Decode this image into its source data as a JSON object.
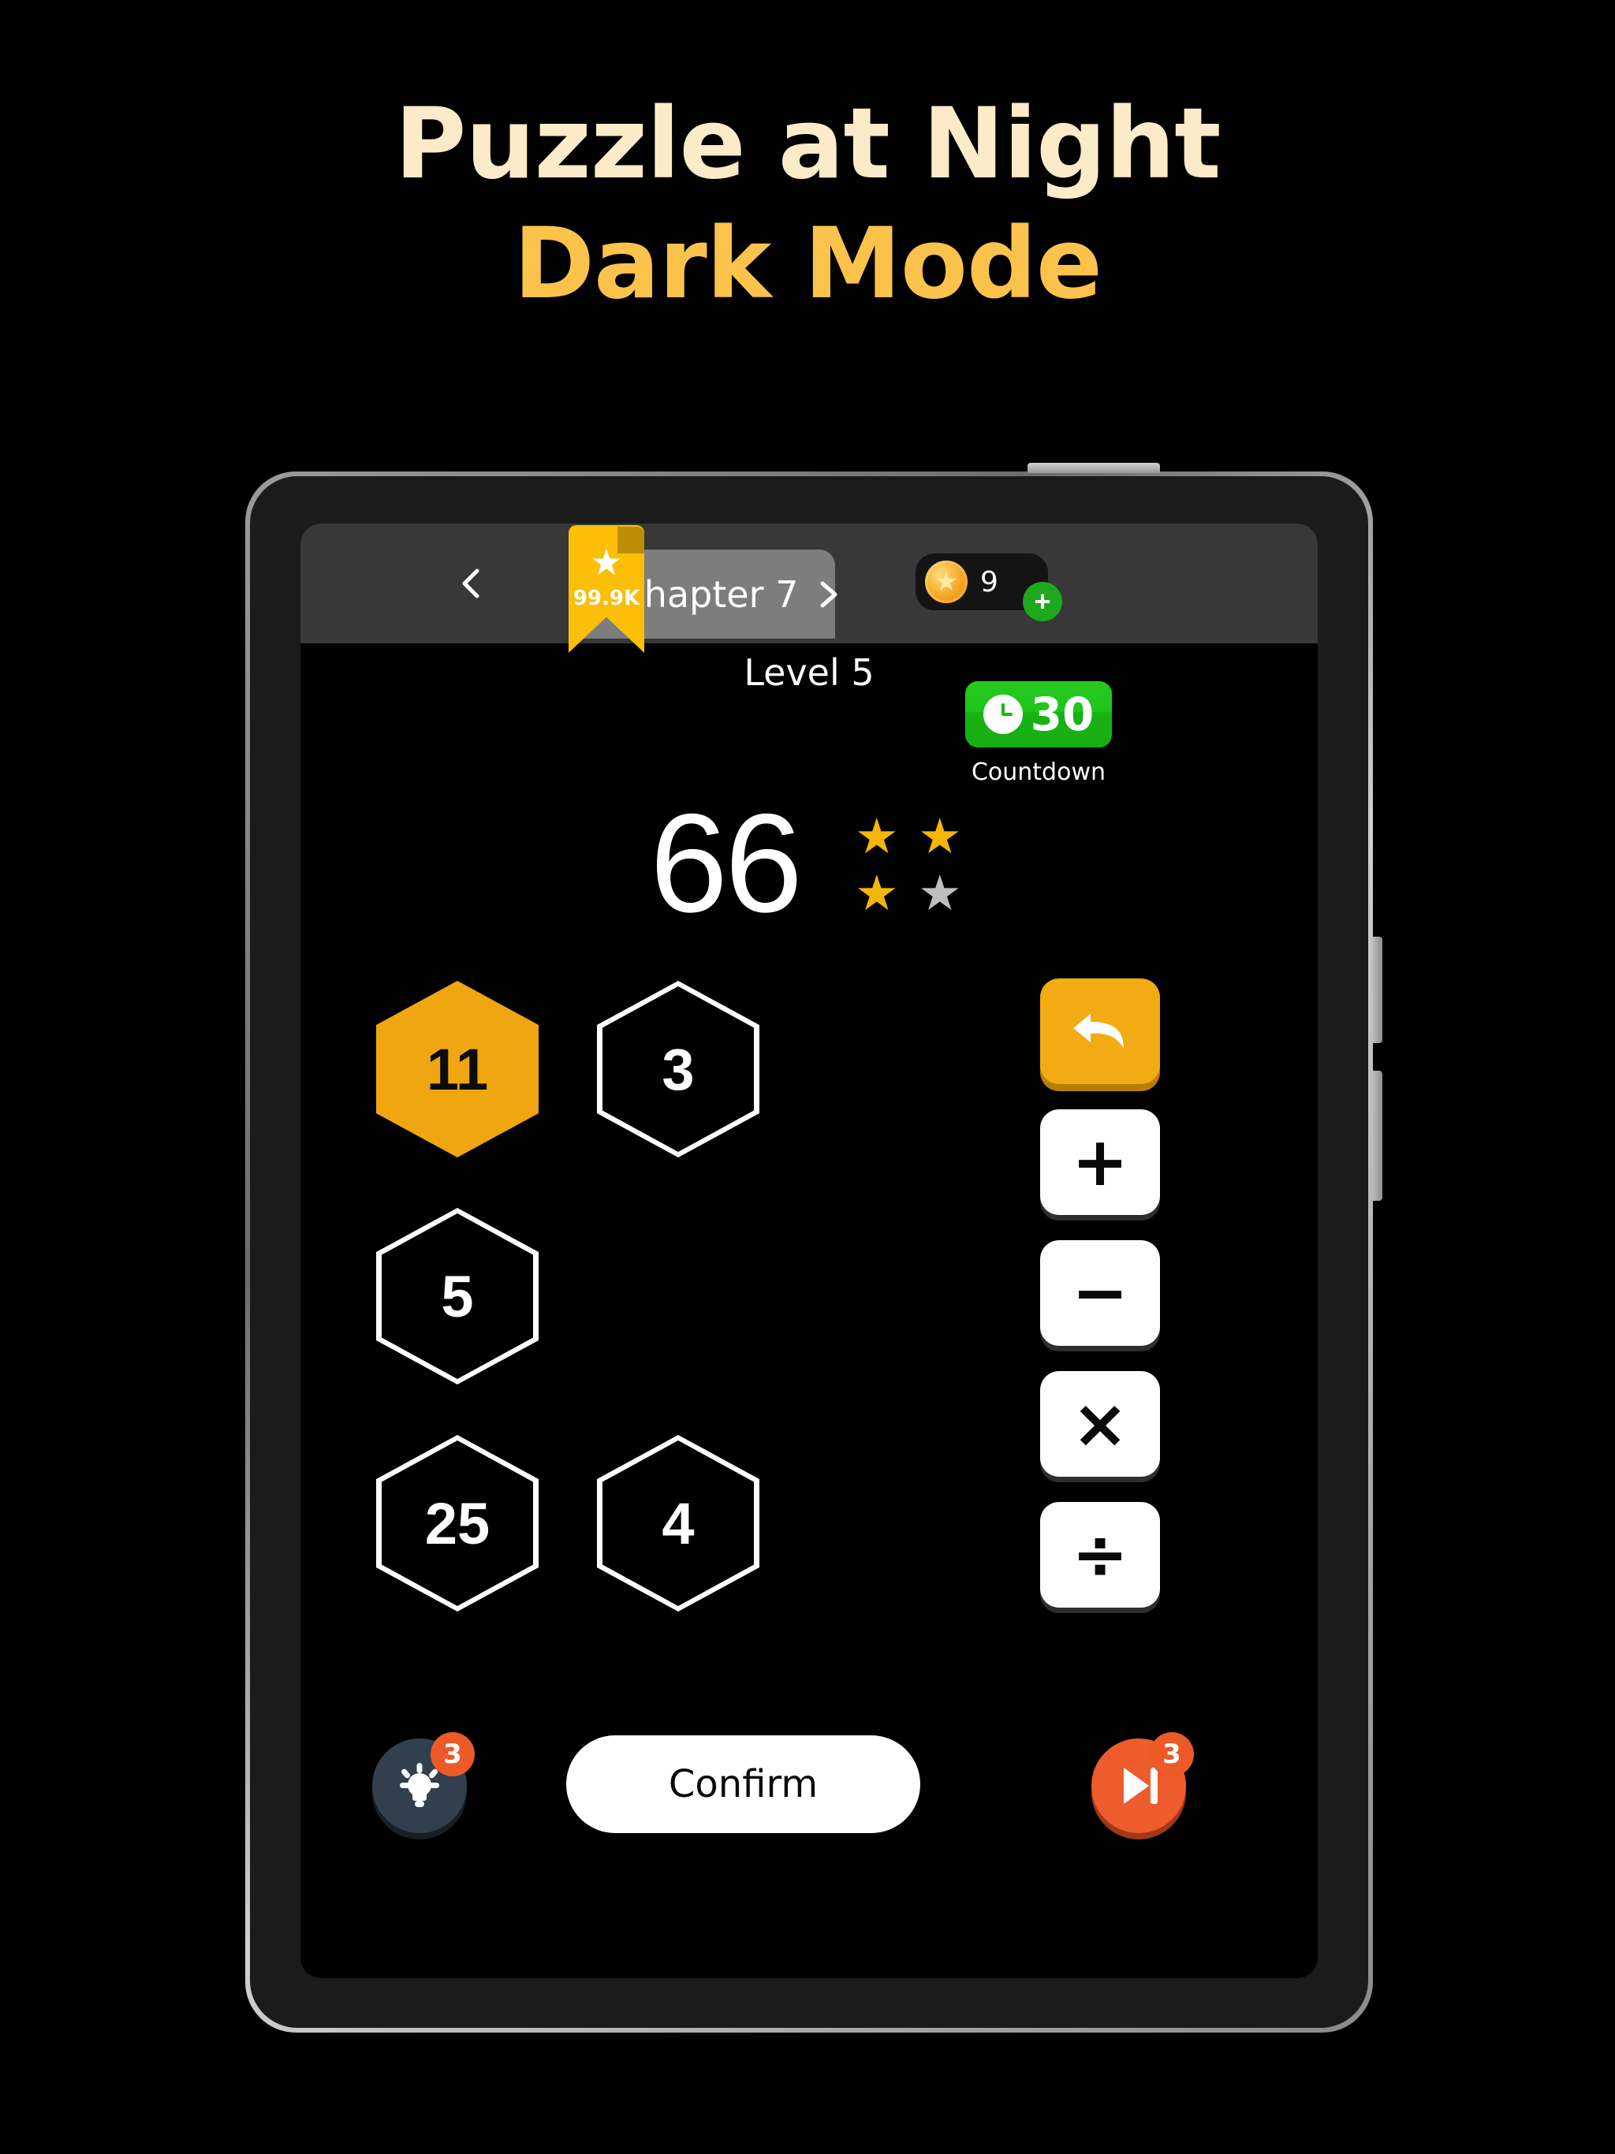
{
  "promo": {
    "title": "Puzzle at Night",
    "subtitle": "Dark Mode",
    "title_color": "#FBEBC8",
    "subtitle_color": "#FBC34B"
  },
  "topbar": {
    "back_icon": "chevron-left-icon",
    "ribbon": {
      "star_icon": "star-icon",
      "count": "99.9K"
    },
    "chapter": {
      "label": "Chapter 7",
      "next_icon": "chevron-right-icon"
    },
    "coins": {
      "icon": "coin-star-icon",
      "amount": "9",
      "add_label": "+",
      "add_color": "#1DA81D"
    }
  },
  "game": {
    "level_label": "Level 5",
    "countdown": {
      "icon": "clock-icon",
      "value": "30",
      "label": "Countdown",
      "color": "#21C41C"
    },
    "target": "66",
    "stars": [
      {
        "state": "on"
      },
      {
        "state": "on"
      },
      {
        "state": "on"
      },
      {
        "state": "off"
      }
    ],
    "star_on_color": "#F5B609",
    "star_off_color": "#BEBEBE",
    "tiles": [
      {
        "value": "11",
        "selected": true
      },
      {
        "value": "3",
        "selected": false
      },
      {
        "value": "5",
        "selected": false
      },
      {
        "value": "25",
        "selected": false
      },
      {
        "value": "4",
        "selected": false
      }
    ],
    "tile_selected_color": "#EFA610",
    "operators": [
      {
        "name": "undo",
        "symbol": "",
        "icon": "undo-arrow-icon",
        "style": "amber"
      },
      {
        "name": "add",
        "symbol": "+",
        "icon": "plus-icon",
        "style": "white"
      },
      {
        "name": "subtract",
        "symbol": "−",
        "icon": "minus-icon",
        "style": "white"
      },
      {
        "name": "multiply",
        "symbol": "×",
        "icon": "multiply-icon",
        "style": "white"
      },
      {
        "name": "divide",
        "symbol": "÷",
        "icon": "divide-icon",
        "style": "white"
      }
    ]
  },
  "bottom": {
    "hint": {
      "icon": "lightbulb-icon",
      "badge": "3"
    },
    "confirm_label": "Confirm",
    "skip": {
      "icon": "skip-forward-icon",
      "badge": "3"
    },
    "badge_color": "#EC5A28"
  }
}
